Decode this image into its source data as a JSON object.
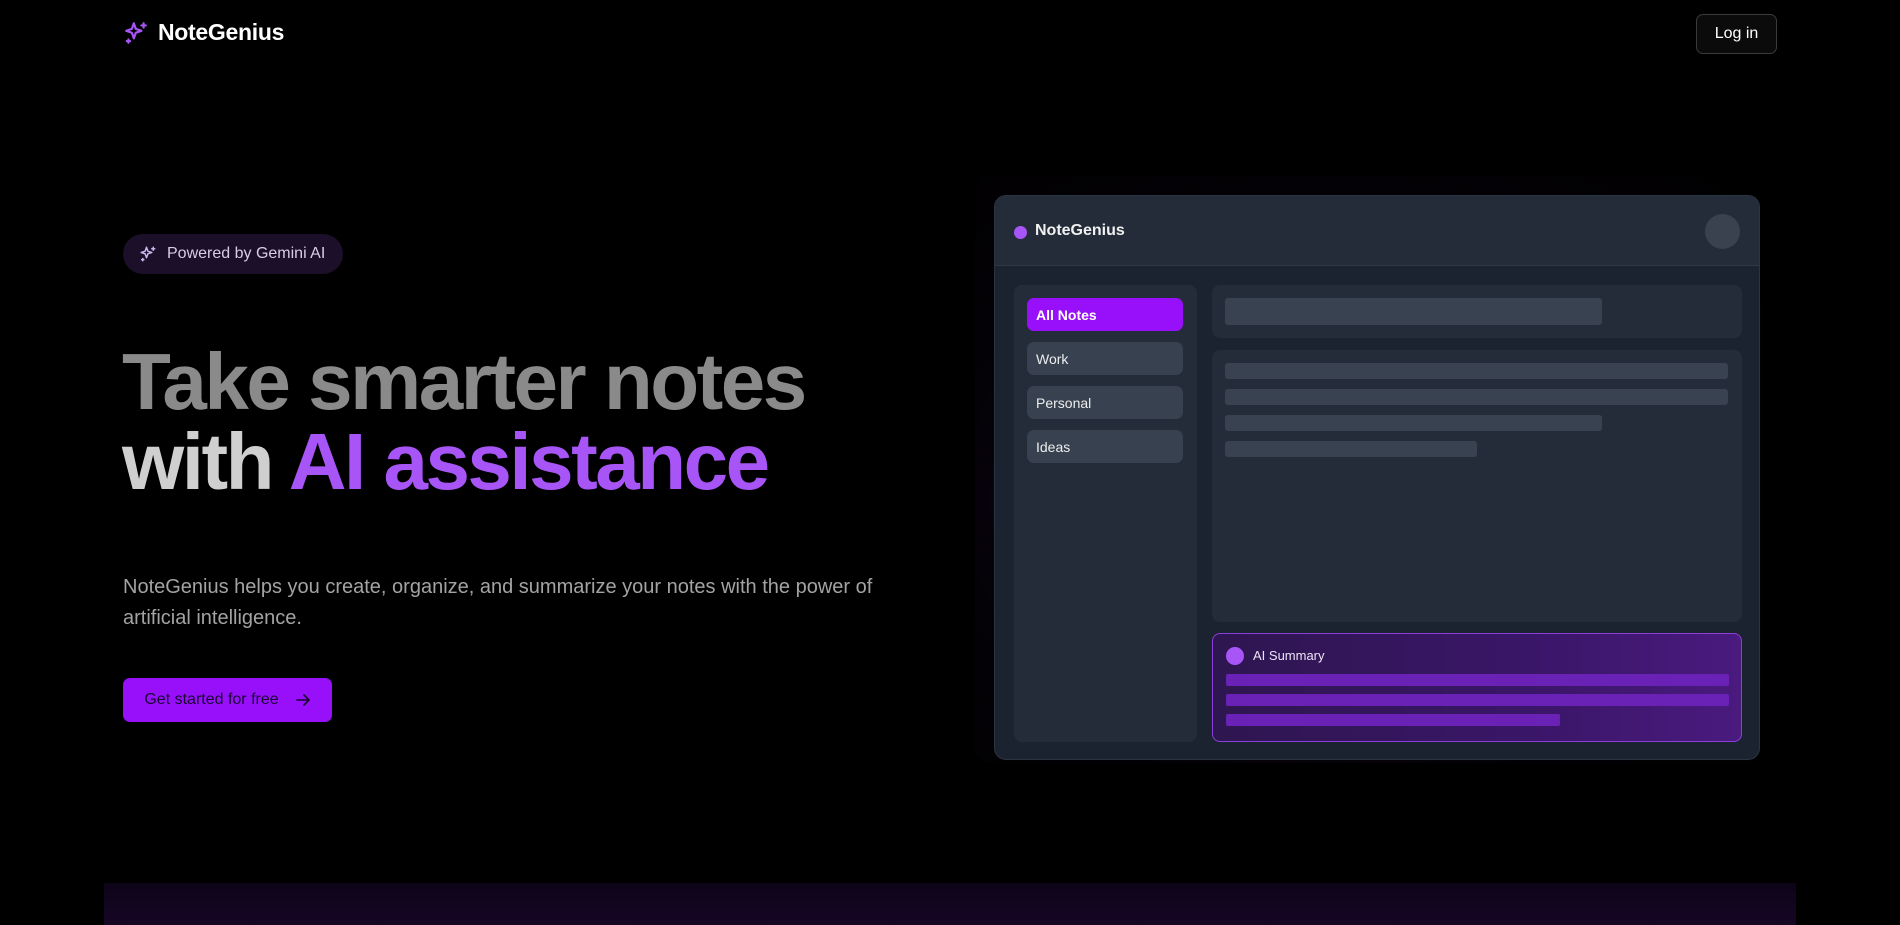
{
  "header": {
    "brand_name": "NoteGenius",
    "brand_icon": "sparkles-icon",
    "login_label": "Log in"
  },
  "hero": {
    "badge_text": "Powered by Gemini AI",
    "headline_line1": "Take smarter notes",
    "headline_line2_prefix": "with ",
    "headline_line2_highlight": "AI assistance",
    "subtitle": "NoteGenius helps you create, organize, and summarize your notes with the power of artificial intelligence.",
    "cta_label": "Get started for free"
  },
  "mockup": {
    "app_title": "NoteGenius",
    "sidebar_items": [
      {
        "label": "All Notes",
        "active": true
      },
      {
        "label": "Work",
        "active": false
      },
      {
        "label": "Personal",
        "active": false
      },
      {
        "label": "Ideas",
        "active": false
      }
    ],
    "summary_title": "AI Summary"
  },
  "colors": {
    "accent": "#9810fa",
    "accent_light": "#a855f7",
    "background": "#000000",
    "mock_panel": "#242c39"
  }
}
